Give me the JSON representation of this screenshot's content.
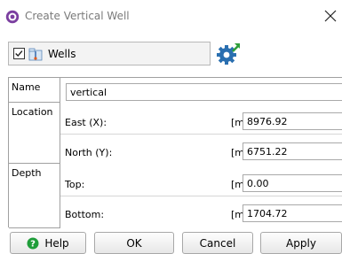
{
  "window": {
    "title": "Create Vertical Well",
    "app_icon": "petrel-app-icon",
    "close_icon": "close-icon"
  },
  "toolbar": {
    "checkbox_checked": true,
    "folder_icon": "wells-folder-icon",
    "folder_label": "Wells",
    "settings_icon": "gear-with-arrow-icon"
  },
  "form": {
    "name": {
      "section_label": "Name",
      "value": "vertical"
    },
    "location": {
      "section_label": "Location",
      "east": {
        "label": "East (X):",
        "unit": "[m]",
        "value": "8976.92"
      },
      "north": {
        "label": "North (Y):",
        "unit": "[m]",
        "value": "6751.22"
      }
    },
    "depth": {
      "section_label": "Depth",
      "top": {
        "label": "Top:",
        "unit": "[m]",
        "value": "0.00"
      },
      "bottom": {
        "label": "Bottom:",
        "unit": "[m]",
        "value": "1704.72"
      }
    }
  },
  "buttons": {
    "help": "Help",
    "ok": "OK",
    "cancel": "Cancel",
    "apply": "Apply"
  },
  "colors": {
    "app_icon": "#7b3fa0",
    "gear": "#2a6fb0",
    "arrow": "#2e9e3a",
    "help_icon": "#1f9d3a"
  }
}
